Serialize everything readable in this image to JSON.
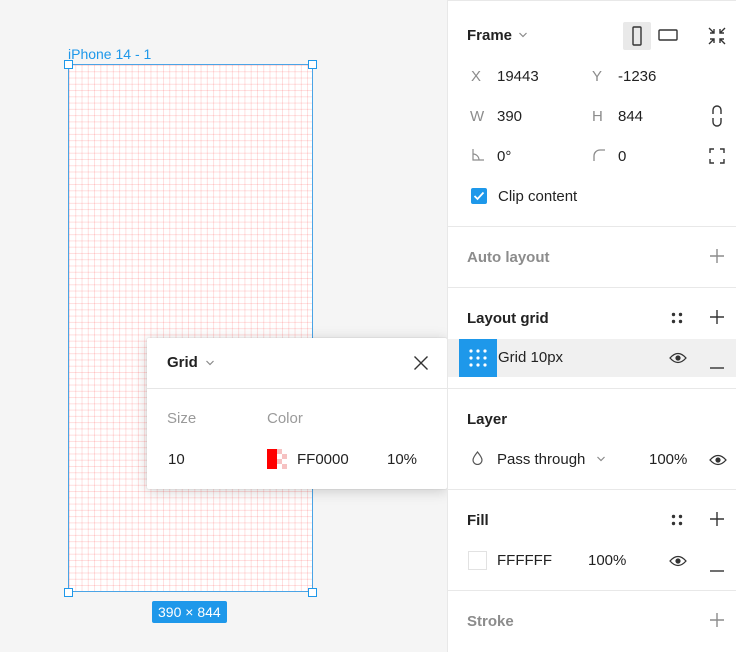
{
  "canvas": {
    "frame_label": "iPhone 14 - 1",
    "size_badge": "390 × 844"
  },
  "grid_popover": {
    "title": "Grid",
    "size_label": "Size",
    "color_label": "Color",
    "size_value": "10",
    "color_hex": "FF0000",
    "opacity": "10%"
  },
  "panel": {
    "frame": {
      "title": "Frame",
      "x_label": "X",
      "x_value": "19443",
      "y_label": "Y",
      "y_value": "-1236",
      "w_label": "W",
      "w_value": "390",
      "h_label": "H",
      "h_value": "844",
      "rotation_value": "0°",
      "radius_value": "0",
      "clip_content_label": "Clip content",
      "clip_content_checked": true
    },
    "auto_layout": {
      "title": "Auto layout"
    },
    "layout_grid": {
      "title": "Layout grid",
      "item_label": "Grid 10px"
    },
    "layer": {
      "title": "Layer",
      "blend_mode": "Pass through",
      "opacity": "100%"
    },
    "fill": {
      "title": "Fill",
      "hex": "FFFFFF",
      "opacity": "100%"
    },
    "stroke": {
      "title": "Stroke"
    }
  },
  "colors": {
    "accent": "#1e98ea",
    "grid_red": "#ff0000"
  }
}
